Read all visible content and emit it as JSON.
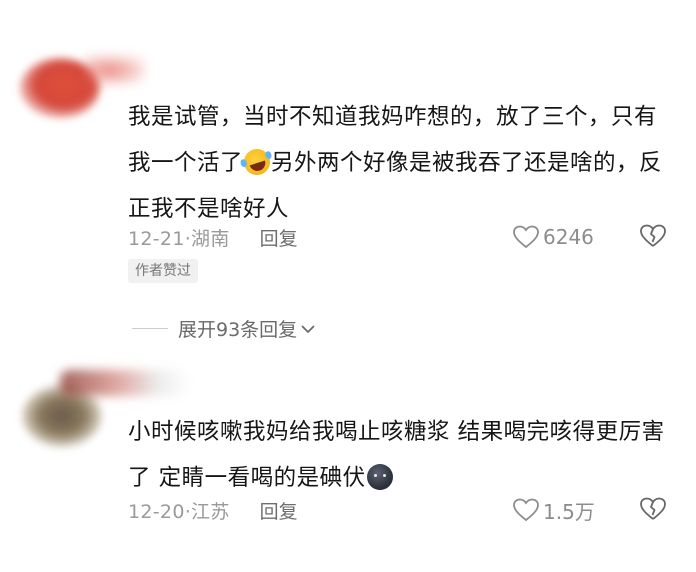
{
  "comments": [
    {
      "text_before_emoji": "我是试管，当时不知道我妈咋想的，放了三个，只有我一个活了",
      "emoji": "laughing-crying-emoji",
      "text_after_emoji": "另外两个好像是被我吞了还是啥的，反正我不是啥好人",
      "date": "12-21·湖南",
      "reply_label": "回复",
      "likes": "6246",
      "author_liked_badge": "作者赞过"
    },
    {
      "text_before_emoji": "小时候咳嗽我妈给我喝止咳糖浆 结果喝完咳得更厉害了 定睛一看喝的是碘伏",
      "emoji": "dark-face-emoji",
      "text_after_emoji": "",
      "date": "12-20·江苏",
      "reply_label": "回复",
      "likes": "1.5万"
    }
  ],
  "expand_replies": {
    "label": "展开93条回复"
  }
}
